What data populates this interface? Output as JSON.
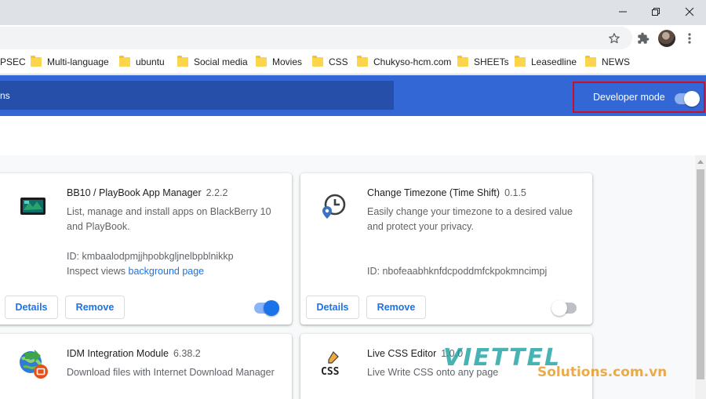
{
  "window": {
    "minimize_icon": "minimize-icon",
    "maximize_icon": "restore-icon",
    "close_icon": "close-icon"
  },
  "toolbar": {
    "icons": [
      "star-icon",
      "puzzle-icon",
      "avatar",
      "kebab-icon"
    ]
  },
  "bookmarks": [
    {
      "label": "PSEC",
      "folder": false
    },
    {
      "label": "Multi-language",
      "folder": true
    },
    {
      "label": "ubuntu",
      "folder": true
    },
    {
      "label": "Social media",
      "folder": true
    },
    {
      "label": "Movies",
      "folder": true
    },
    {
      "label": "CSS",
      "folder": true
    },
    {
      "label": "Chukyso-hcm.com",
      "folder": true
    },
    {
      "label": "SHEETs",
      "folder": true
    },
    {
      "label": "Leasedline",
      "folder": true
    },
    {
      "label": "NEWS",
      "folder": true
    }
  ],
  "header": {
    "search_text": "ns",
    "developer_mode_label": "Developer mode",
    "developer_mode_on": true,
    "accent": "#3367d6"
  },
  "extensions": [
    {
      "name": "BB10 / PlayBook App Manager",
      "version": "2.2.2",
      "description": "List, manage and install apps on BlackBerry 10 and PlayBook.",
      "id_line": "ID: kmbaalodpmjjhpobkgljnelbpblnikkp",
      "inspect_prefix": "Inspect views",
      "inspect_link": "background page",
      "details": "Details",
      "remove": "Remove",
      "enabled": true,
      "icon": "blackberry-playbook-icon"
    },
    {
      "name": "Change Timezone (Time Shift)",
      "version": "0.1.5",
      "description": "Easily change your timezone to a desired value and protect your privacy.",
      "id_line": "ID: nbofeaabhknfdcpoddmfckpokmncimpj",
      "details": "Details",
      "remove": "Remove",
      "enabled": false,
      "icon": "clock-location-icon"
    },
    {
      "name": "IDM Integration Module",
      "version": "6.38.2",
      "description": "Download files with Internet Download Manager",
      "icon": "idm-globe-icon"
    },
    {
      "name": "Live CSS Editor",
      "version": "1.0.0",
      "description": "Live Write CSS onto any page",
      "icon": "css-pencil-icon"
    }
  ],
  "watermark": {
    "top": "VIETTEL",
    "bottom": "Solutions.com.vn"
  }
}
